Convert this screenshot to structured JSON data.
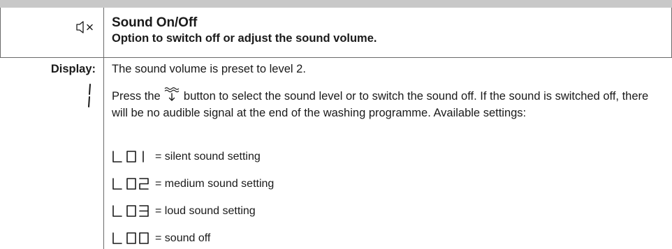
{
  "header": {
    "title": "Sound On/Off",
    "subtitle": "Option to switch off or adjust the sound volume."
  },
  "display": {
    "label": "Display:",
    "intro": "The sound volume is preset to level 2.",
    "instruction_before": "Press the",
    "instruction_after": "button to select the sound level or to switch the sound off. If the sound is switched off, there will be no audible signal at the end of the washing programme. Available settings:",
    "button_icon": "sound-wave-button-icon"
  },
  "settings": [
    {
      "code": "L01",
      "label": "= silent sound setting"
    },
    {
      "code": "L02",
      "label": "= medium sound setting"
    },
    {
      "code": "L03",
      "label": "= loud sound setting"
    },
    {
      "code": "L00",
      "label": "= sound off"
    }
  ],
  "icons": {
    "mute": "mute-speaker-icon",
    "level_indicator": "segment-one-icon"
  },
  "colors": {
    "header_bar": "#c8c8c8",
    "grid": "#6a6a6a",
    "text": "#1a1a1a"
  }
}
